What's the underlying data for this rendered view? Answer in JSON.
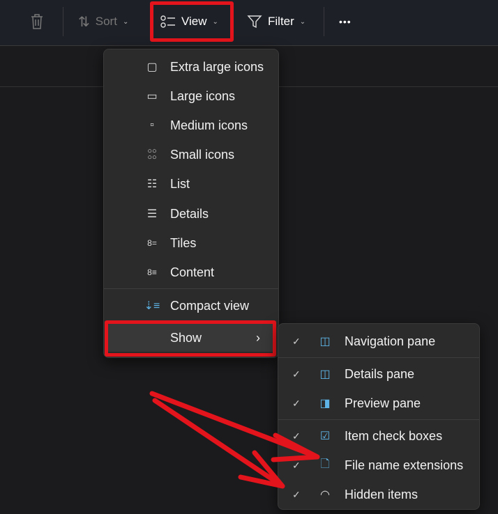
{
  "toolbar": {
    "sort": "Sort",
    "view": "View",
    "filter": "Filter",
    "more": "•••"
  },
  "view_menu": {
    "items": [
      "Extra large icons",
      "Large icons",
      "Medium icons",
      "Small icons",
      "List",
      "Details",
      "Tiles",
      "Content"
    ],
    "compact": "Compact view",
    "show": "Show",
    "show_arrow": "›"
  },
  "show_menu": {
    "check": "✓",
    "items": [
      "Navigation pane",
      "Details pane",
      "Preview pane",
      "Item check boxes",
      "File name extensions",
      "Hidden items"
    ]
  },
  "colors": {
    "highlight": "#e3141b",
    "accent": "#5eb4e6"
  }
}
